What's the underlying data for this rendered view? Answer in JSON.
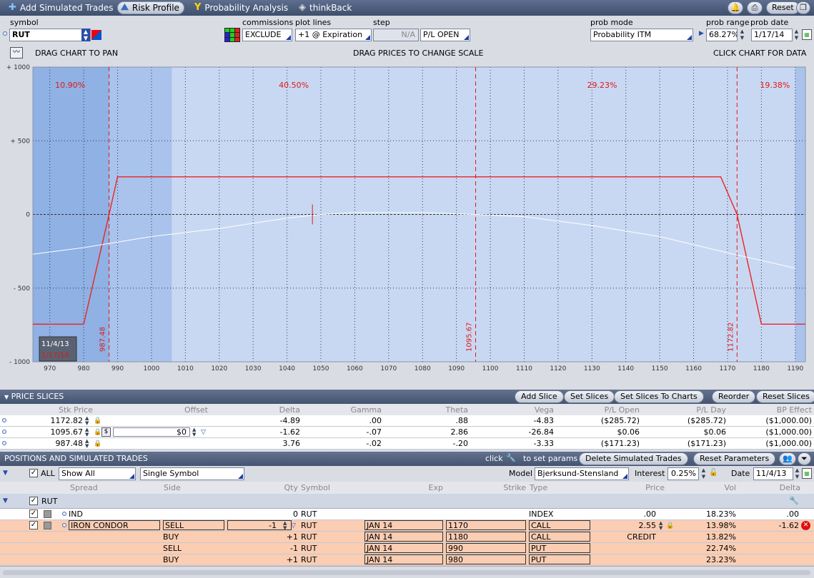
{
  "toolbar": {
    "add_simulated_trades": "Add Simulated Trades",
    "risk_profile": "Risk Profile",
    "probability_analysis": "Probability Analysis",
    "thinkback": "thinkBack",
    "reset": "Reset"
  },
  "params": {
    "symbol_label": "symbol",
    "symbol_value": "RUT",
    "commissions_label": "commissions",
    "commissions_value": "EXCLUDE",
    "plot_lines_label": "plot lines",
    "plot_lines_value": "+1 @ Expiration",
    "step_label": "step",
    "step_value": "N/A",
    "pl_mode": "P/L OPEN",
    "prob_mode_label": "prob mode",
    "prob_mode_value": "Probability ITM",
    "prob_range_label": "prob range",
    "prob_range_value": "68.27%",
    "prob_date_label": "prob date",
    "prob_date_value": "1/17/14"
  },
  "chart_bar": {
    "drag_pan": "DRAG CHART TO PAN",
    "drag_prices": "DRAG PRICES TO CHANGE SCALE",
    "click_chart": "CLICK CHART FOR DATA"
  },
  "chart_data": {
    "type": "line",
    "x_ticks": [
      970,
      980,
      990,
      1000,
      1010,
      1020,
      1030,
      1040,
      1050,
      1060,
      1070,
      1080,
      1090,
      1100,
      1110,
      1120,
      1130,
      1140,
      1150,
      1160,
      1170,
      1180,
      1190
    ],
    "y_ticks": [
      {
        "v": 1000,
        "label": "+ 1000"
      },
      {
        "v": 500,
        "label": "+ 500"
      },
      {
        "v": 0,
        "label": "0"
      },
      {
        "v": -500,
        "label": "- 500"
      },
      {
        "v": -1000,
        "label": "- 1000"
      }
    ],
    "xlim": [
      965,
      1193
    ],
    "ylim": [
      -1000,
      1000
    ],
    "series": [
      {
        "color": "#ee2222",
        "points": [
          [
            965,
            -745
          ],
          [
            980,
            -745
          ],
          [
            987.48,
            0
          ],
          [
            990,
            255
          ],
          [
            1168,
            255
          ],
          [
            1172.82,
            0
          ],
          [
            1180,
            -745
          ],
          [
            1193,
            -745
          ]
        ]
      },
      {
        "color": "#ffffff",
        "points": [
          [
            965,
            -270
          ],
          [
            980,
            -225
          ],
          [
            1000,
            -150
          ],
          [
            1020,
            -95
          ],
          [
            1040,
            -25
          ],
          [
            1050,
            0
          ],
          [
            1060,
            12
          ],
          [
            1080,
            12
          ],
          [
            1095.67,
            0
          ],
          [
            1110,
            -15
          ],
          [
            1130,
            -75
          ],
          [
            1150,
            -150
          ],
          [
            1170,
            -260
          ],
          [
            1190,
            -365
          ]
        ]
      }
    ],
    "slice_lines": [
      {
        "x": 987.48,
        "label": "987.48"
      },
      {
        "x": 1095.67,
        "label": "1095.67"
      },
      {
        "x": 1172.82,
        "label": "1172.82"
      }
    ],
    "current_marker_x": 1047.5,
    "prob_labels": [
      {
        "x": 976,
        "label": "10.90%"
      },
      {
        "x": 1042,
        "label": "40.50%"
      },
      {
        "x": 1133,
        "label": "29.23%"
      },
      {
        "x": 1184,
        "label": "19.38%"
      }
    ],
    "date_legend": [
      "11/4/13",
      "1/17/14"
    ]
  },
  "price_slices": {
    "title": "PRICE SLICES",
    "buttons": [
      "Add Slice",
      "Set Slices",
      "Set Slices To Charts",
      "Reorder",
      "Reset Slices"
    ],
    "columns": [
      "Stk Price",
      "Offset",
      "Delta",
      "Gamma",
      "Theta",
      "Vega",
      "P/L Open",
      "P/L Day",
      "BP Effect"
    ],
    "rows": [
      {
        "price": "1172.82",
        "offset": "",
        "delta": "-4.89",
        "gamma": ".00",
        "theta": ".88",
        "vega": "-4.83",
        "pl_open": "($285.72)",
        "pl_day": "($285.72)",
        "bp": "($1,000.00)"
      },
      {
        "price": "1095.67",
        "offset": "$0",
        "delta": "-1.62",
        "gamma": "-.07",
        "theta": "2.86",
        "vega": "-26.84",
        "pl_open": "$0.06",
        "pl_day": "$0.06",
        "bp": "($1,000.00)"
      },
      {
        "price": "987.48",
        "offset": "",
        "delta": "3.76",
        "gamma": "-.02",
        "theta": "-.20",
        "vega": "-3.33",
        "pl_open": "($171.23)",
        "pl_day": "($171.23)",
        "bp": "($1,000.00)"
      }
    ]
  },
  "positions": {
    "title": "POSITIONS AND SIMULATED TRADES",
    "click_hint_pre": "click",
    "click_hint_post": "to set params",
    "delete_btn": "Delete Simulated Trades",
    "reset_params_btn": "Reset Parameters",
    "all_label": "ALL",
    "show_all": "Show All",
    "single_symbol": "Single Symbol",
    "model_label": "Model",
    "model_value": "Bjerksund-Stensland",
    "interest_label": "Interest",
    "interest_value": "0.25%",
    "date_label": "Date",
    "date_value": "11/4/13",
    "columns": [
      "Spread",
      "Side",
      "Qty",
      "Symbol",
      "Exp",
      "Strike",
      "Type",
      "Price",
      "Vol",
      "Delta"
    ],
    "group_symbol": "RUT",
    "rows": [
      {
        "spread": "IND",
        "side": "",
        "qty": "0",
        "symbol": "RUT",
        "exp": "",
        "strike": "",
        "type": "INDEX",
        "price": ".00",
        "vol": "18.23%",
        "delta": ".00"
      },
      {
        "spread": "IRON CONDOR",
        "side": "SELL",
        "qty": "-1",
        "symbol": "RUT",
        "exp": "JAN 14",
        "strike": "1170",
        "type": "CALL",
        "price": "2.55",
        "vol": "13.98%",
        "delta": "-1.62"
      },
      {
        "spread": "",
        "side": "BUY",
        "qty": "+1",
        "symbol": "RUT",
        "exp": "JAN 14",
        "strike": "1180",
        "type": "CALL",
        "price": "CREDIT",
        "vol": "13.82%",
        "delta": ""
      },
      {
        "spread": "",
        "side": "SELL",
        "qty": "-1",
        "symbol": "RUT",
        "exp": "JAN 14",
        "strike": "990",
        "type": "PUT",
        "price": "",
        "vol": "22.74%",
        "delta": ""
      },
      {
        "spread": "",
        "side": "BUY",
        "qty": "+1",
        "symbol": "RUT",
        "exp": "JAN 14",
        "strike": "980",
        "type": "PUT",
        "price": "",
        "vol": "23.23%",
        "delta": ""
      }
    ]
  }
}
